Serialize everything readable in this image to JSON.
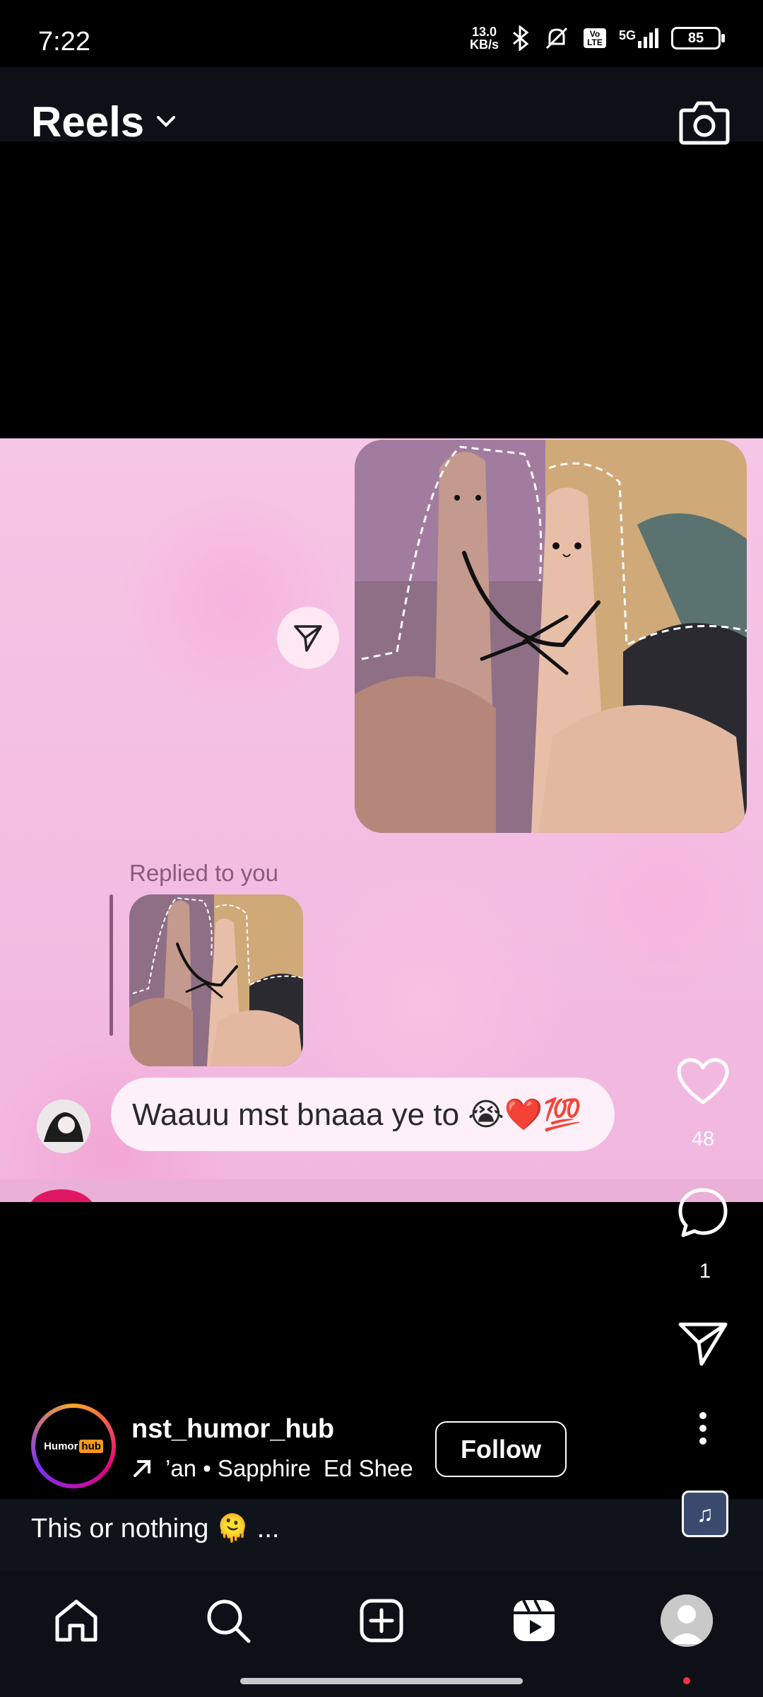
{
  "status_bar": {
    "time": "7:22",
    "net_speed_value": "13.0",
    "net_speed_unit": "KB/s",
    "network": "5G",
    "volte": "Vo LTE",
    "battery": "85"
  },
  "header": {
    "title": "Reels"
  },
  "reel": {
    "replied_label": "Replied to you",
    "message_text": "Waauu mst bnaaa ye to 😭❤️💯",
    "likes": "48",
    "comments": "1"
  },
  "author": {
    "username": "nst_humor_hub",
    "logo_text": "Humor",
    "logo_hub": "hub",
    "music_track": "’an • Sapphire",
    "music_artist": "Ed Shee",
    "follow_label": "Follow"
  },
  "caption": {
    "text": "This or nothing 🫠 ..."
  },
  "icons": {
    "like": "heart-icon",
    "comment": "comment-icon",
    "share": "send-icon",
    "more": "more-vertical-icon",
    "audio": "music-note-icon",
    "camera": "camera-icon"
  },
  "colors": {
    "background": "#000000",
    "header": "#0d1117",
    "notification_dot": "#ff3040",
    "video_pink": "#f3bde2"
  }
}
